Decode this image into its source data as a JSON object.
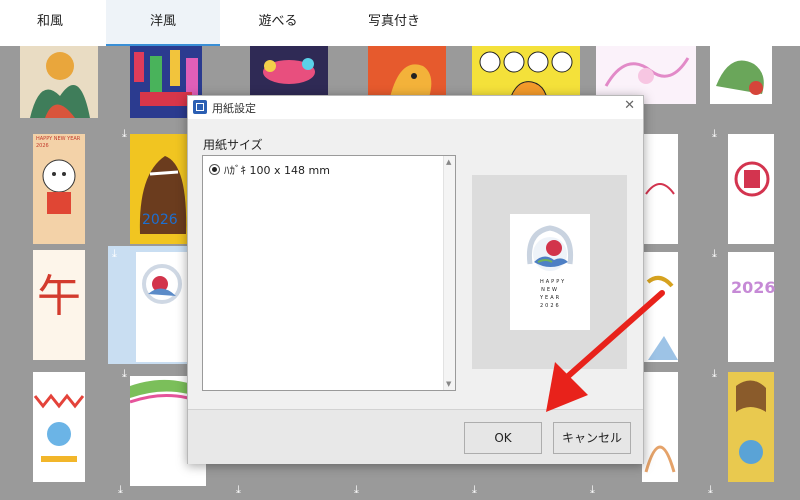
{
  "tabs": [
    {
      "label": "和風"
    },
    {
      "label": "洋風"
    },
    {
      "label": "遊べる"
    },
    {
      "label": "写真付き"
    }
  ],
  "active_tab": "洋風",
  "download_icon": "download-arrow",
  "dialog": {
    "title": "用紙設定",
    "close_icon": "close-icon",
    "size_label": "用紙サイズ",
    "paper_sizes": [
      {
        "label": "ﾊｶﾞｷ 100 x 148 mm",
        "selected": true
      }
    ],
    "ok_label": "OK",
    "cancel_label": "キャンセル"
  },
  "card_texts": {
    "happy_new_year": "HAPPY NEW YEAR",
    "year_digits": "2026",
    "kanji": "午",
    "hny_stack": "HAPPY NEW YEAR 2026",
    "new_year_vertical": "HAPPY NEW YEAR"
  },
  "colors": {
    "accent": "#3a8fd6",
    "arrow": "#e8221b",
    "grid_bg": "#9a9a9a"
  }
}
